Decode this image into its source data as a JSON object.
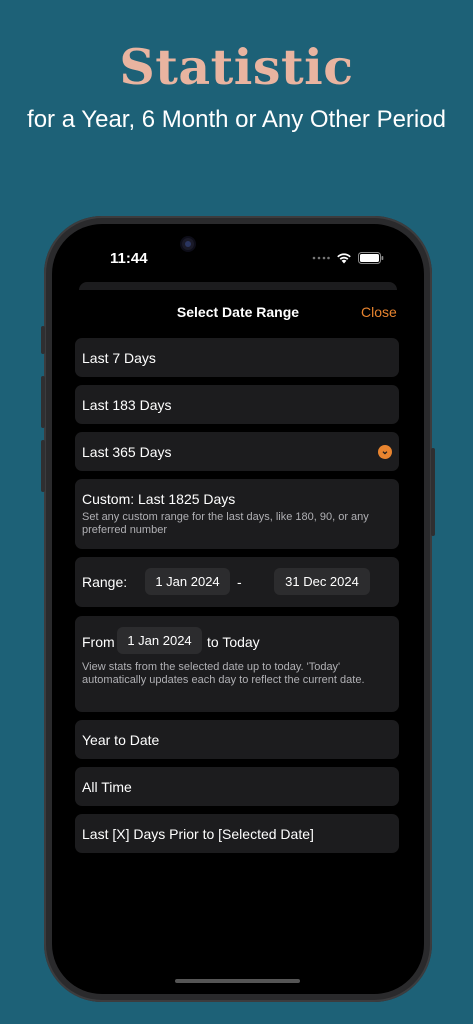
{
  "hero": {
    "title": "Statistic",
    "subtitle": "for a Year, 6 Month or Any Other Period"
  },
  "status_bar": {
    "time": "11:44",
    "icons": [
      "cellular-dots-icon",
      "wifi-icon",
      "battery-icon"
    ]
  },
  "sheet": {
    "title": "Select Date Range",
    "close_label": "Close",
    "accent_color": "#e8842f",
    "options": {
      "last7": "Last 7 Days",
      "last183": "Last 183 Days",
      "last365": "Last 365 Days",
      "custom_label": "Custom: Last 1825 Days",
      "custom_desc": "Set any custom range for the last days, like 180, 90, or any preferred number",
      "range_label": "Range:",
      "range_start": "1 Jan 2024",
      "range_sep": "-",
      "range_end": "31 Dec 2024",
      "from_label": "From",
      "from_date": "1 Jan 2024",
      "to_today": "to Today",
      "from_desc": "View stats from the selected date up to today. 'Today' automatically updates each day to reflect the current date.",
      "ytd": "Year to Date",
      "all_time": "All Time",
      "prior": "Last [X] Days Prior to [Selected Date]"
    }
  }
}
